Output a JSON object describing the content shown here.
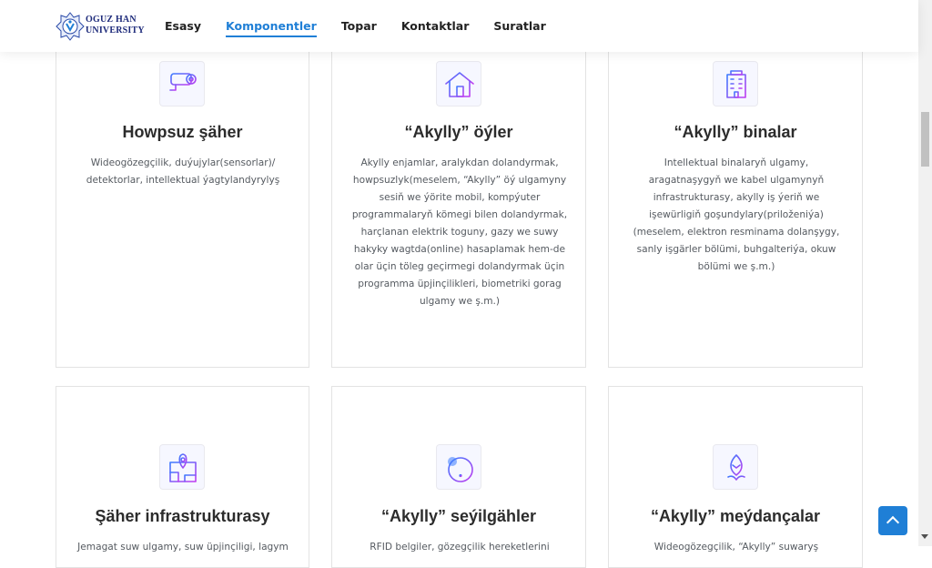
{
  "header": {
    "logo_line1": "OGUZ HAN",
    "logo_line2": "UNIVERSITY",
    "nav": [
      "Esasy",
      "Komponentler",
      "Topar",
      "Kontaktlar",
      "Suratlar"
    ],
    "active_nav": "Komponentler"
  },
  "cards": [
    {
      "title": "Howpsuz şäher",
      "icon": "security-camera-icon",
      "description": "Wideogözegçilik, duýujylar(sensorlar)/ detektorlar, intellektual ýagtylandyrylyş"
    },
    {
      "title": "“Akylly” öýler",
      "icon": "smart-home-icon",
      "description": "Akylly enjamlar, aralykdan dolandyrmak, howpsuzlyk(meselem, “Akylly” öý ulgamyny sesiň we ýörite mobil, kompýuter programmalaryň kömegi bilen dolandyrmak, harçlanan elektrik toguny, gazy we suwy hakyky wagtda(online) hasaplamak hem-de olar üçin töleg geçirmegi dolandyrmak üçin programma üpjinçilikleri, biometriki gorag ulgamy we ş.m.)"
    },
    {
      "title": "“Akylly” binalar",
      "icon": "smart-building-icon",
      "description": "Intellektual binalaryň ulgamy, aragatnaşygyň we kabel ulgamynyň infrastrukturasy, akylly iş ýeriň we işewürligiň goşundylary(priloženiýa) (meselem, elektron resminama dolanşygy, sanly işgärler bölümi, buhgalteriýa, okuw bölümi we ş.m.)"
    },
    {
      "title": "Şäher infrastrukturasy",
      "icon": "city-map-icon",
      "description": "Jemagat suw ulgamy, suw üpjinçiligi, lagym"
    },
    {
      "title": "“Akylly” seýilgähler",
      "icon": "smart-park-icon",
      "description": "RFID belgiler, gözegçilik hereketlerini"
    },
    {
      "title": "“Akylly” meýdançalar",
      "icon": "leaf-icon",
      "description": "Wideogözegçilik, “Akylly” suwaryş"
    }
  ],
  "colors": {
    "accent": "#1f7fd6",
    "icon_gradient_start": "#3b7bff",
    "icon_gradient_end": "#c13cf0",
    "logo": "#1d2a7a"
  }
}
